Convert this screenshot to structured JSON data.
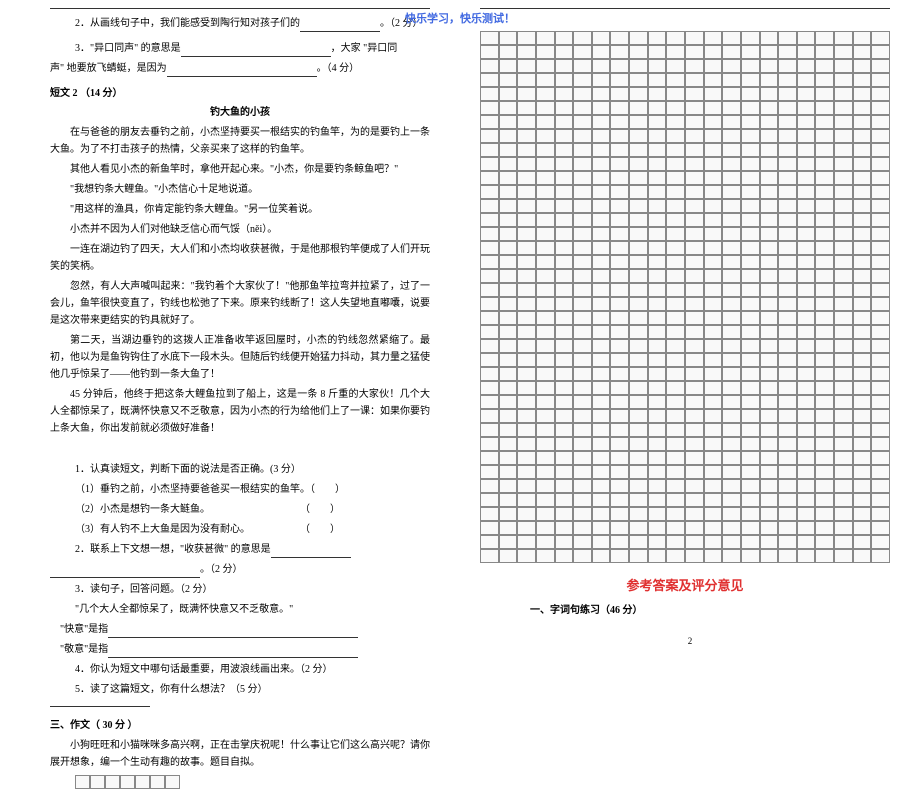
{
  "header": "快乐学习，快乐测试！",
  "q2": {
    "text_a": "2．从画线句子中，我们能感受到陶行知对孩子们的",
    "text_b": "。（2 分）"
  },
  "q3": {
    "text_a": "3．\"异口同声\" 的意思是",
    "text_b": "，大家 \"异口同",
    "text_c": "声\" 地要放飞蜻蜓，是因为",
    "text_d": "。（4 分）"
  },
  "passage2": {
    "heading": "短文 2 （14 分）",
    "title": "钓大鱼的小孩",
    "para1": "在与爸爸的朋友去垂钓之前，小杰坚持要买一根结实的钓鱼竿，为的是要钓上一条大鱼。为了不打击孩子的热情，父亲买来了这样的钓鱼竿。",
    "para2": "其他人看见小杰的新鱼竿时，拿他开起心来。\"小杰，你是要钓条鲸鱼吧？\"",
    "para3": "\"我想钓条大鲤鱼。\"小杰信心十足地说道。",
    "para4": "\"用这样的渔具，你肯定能钓条大鲤鱼。\"另一位笑着说。",
    "para5": "小杰并不因为人们对他缺乏信心而气馁（něi）。",
    "para6": "一连在湖边钓了四天，大人们和小杰均收获甚微，于是他那根钓竿便成了人们开玩笑的笑柄。",
    "para7": "忽然，有人大声喊叫起来：\"我钓着个大家伙了！\"他那鱼竿拉弯并拉紧了，过了一会儿，鱼竿很快变直了，钓线也松弛了下来。原来钓线断了！这人失望地直嘟囔，说要是这次带来更结实的钓具就好了。",
    "para8": "第二天，当湖边垂钓的这拨人正准备收竿返回屋时，小杰的钓线忽然紧缩了。最初，他以为是鱼钩钩住了水底下一段木头。但随后钓线便开始猛力抖动，其力量之猛使他几乎惊呆了——他钓到一条大鱼了！",
    "para9": "45 分钟后，他终于把这条大鲤鱼拉到了船上，这是一条 8 斤重的大家伙！几个大人全都惊呆了，既满怀快意又不乏敬意，因为小杰的行为给他们上了一课：如果你要钓上条大鱼，你出发前就必须做好准备！"
  },
  "p2_questions": {
    "q1": {
      "text": "1．认真读短文，判断下面的说法是否正确。(3 分）",
      "opt1": "（1）垂钓之前，小杰坚持要爸爸买一根结实的鱼竿。（　　）",
      "opt2": "（2）小杰是想钓一条大鲢鱼。　　　　　　　　　　（　　）",
      "opt3": "（3）有人钓不上大鱼是因为没有耐心。　　　　　　（　　）"
    },
    "q2": {
      "text_a": "2．联系上下文想一想，\"收获甚微\" 的意思是",
      "text_b": "。（2 分）"
    },
    "q3": {
      "text": "3．读句子，回答问题。（2 分）",
      "quote": "\"几个大人全都惊呆了，既满怀快意又不乏敬意。\"",
      "ask1": "\"快意\"是指",
      "ask2": "\"敬意\"是指"
    },
    "q4": "4．你认为短文中哪句话最重要，用波浪线画出来。（2 分）",
    "q5": "5．读了这篇短文，你有什么想法？（5 分）"
  },
  "composition": {
    "heading": "三、作文（ 30 分 ）",
    "prompt": "小狗旺旺和小猫咪咪多高兴啊，正在击掌庆祝呢！什么事让它们这么高兴呢？请你展开想象，编一个生动有趣的故事。题目自拟。"
  },
  "answers": {
    "title": "参考答案及评分意见",
    "section1": "一、字词句练习（46 分）"
  },
  "page_number": "2"
}
